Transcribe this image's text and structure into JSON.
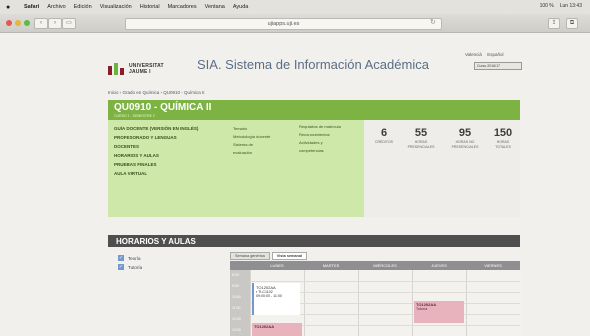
{
  "menubar": {
    "apple": "",
    "items": [
      "Safari",
      "Archivo",
      "Edición",
      "Visualización",
      "Historial",
      "Marcadores",
      "Ventana",
      "Ayuda"
    ],
    "status": [
      "100 %",
      "Lun 13:43"
    ]
  },
  "toolbar": {
    "back": "‹",
    "forward": "›",
    "sidebar": "▭",
    "url": "ujiapps.uji.es",
    "reload": "↻",
    "share": "⇪",
    "tabs": "⧉"
  },
  "brand": {
    "university_line1": "UNIVERSITAT",
    "university_line2": "JAUME I",
    "app_title": "SIA. Sistema de Información Académica"
  },
  "language": [
    "Valencià",
    "Español"
  ],
  "course_select": "Curso 2016/17",
  "breadcrumb": "Inicio › Grado en Química › QU0910 - Química II",
  "breadcrumb_home": "Inicio",
  "subject": {
    "title": "QU0910 - QUÍMICA II",
    "subtitle": "CURSO 1 - SEMESTRE 2"
  },
  "menu_primary": [
    "GUÍA DOCENTE (VERSIÓN EN INGLÉS)",
    "PROFESORADO Y LENGUAS",
    "DOCENTES",
    "HORARIOS Y AULAS",
    "PRUEBAS FINALES",
    "AULA VIRTUAL"
  ],
  "menu_secondary": [
    "Temario",
    "Metodología docente",
    "Sistema de",
    "evaluación"
  ],
  "menu_tertiary": [
    "Requisitos de matrícula",
    "Reconocimientos",
    "Actividades y",
    "competencias"
  ],
  "stats": [
    {
      "value": "6",
      "label": "CRÉDITOS"
    },
    {
      "value": "55",
      "label": "HORAS PRESENCIALES"
    },
    {
      "value": "95",
      "label": "HORAS NO PRESENCIALES"
    },
    {
      "value": "150",
      "label": "HORAS TOTALES"
    }
  ],
  "horarios": {
    "title": "HORARIOS Y AULAS",
    "legend": [
      "Teoría",
      "Tutoría"
    ],
    "tabs": [
      "Semana genérica",
      "Vista semanal"
    ],
    "days": [
      "LUNES",
      "MARTES",
      "MIÉRCOLES",
      "JUEVES",
      "VIERNES"
    ],
    "hours": [
      "8:00",
      "9:00",
      "10:00",
      "11:00",
      "12:00",
      "13:00"
    ],
    "events": [
      {
        "title": "TO1202AA",
        "line2": "▪ TLC1102",
        "line3": "09:00:00 - 11:00"
      },
      {
        "title": "TO1202AA",
        "line2": "Tutoría"
      },
      {
        "title": "TO1202AA",
        "line2": ""
      }
    ]
  },
  "colors": {
    "green_header": "#7cb342",
    "green_panel": "#cde8a8",
    "event_pink": "#e9b3bd",
    "legend_blue": "#7597c9"
  }
}
